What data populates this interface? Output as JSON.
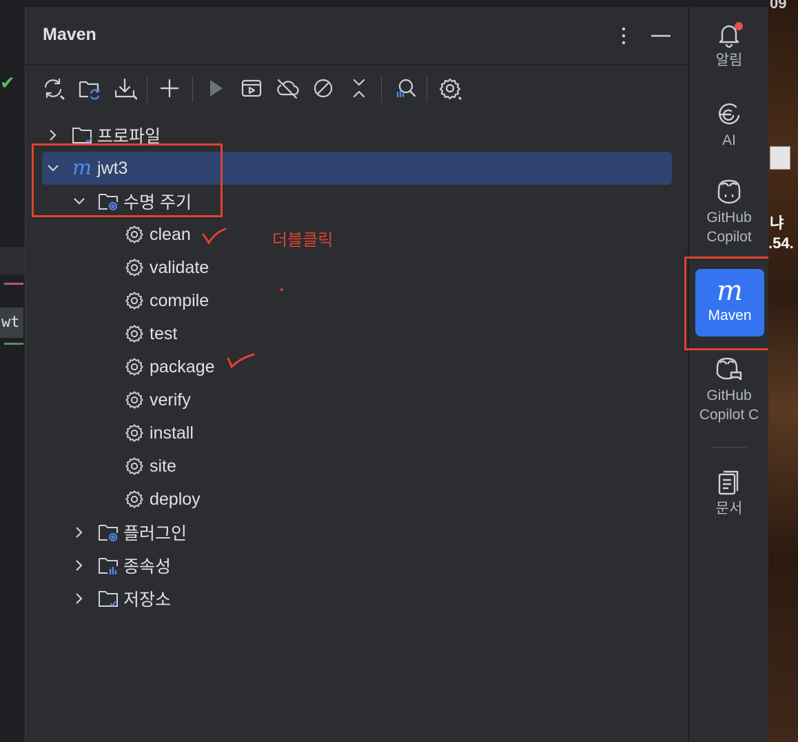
{
  "editor": {
    "tab_fragment": "wt"
  },
  "panel": {
    "title": "Maven"
  },
  "toolbar": {
    "buttons": [
      "reload-all-icon",
      "reload-project-icon",
      "download-icon",
      "add-icon",
      "run-icon",
      "execute-goal-icon",
      "offline-mode-icon",
      "skip-tests-icon",
      "collapse-icon",
      "analyze-dependencies-icon",
      "settings-icon"
    ]
  },
  "tree": {
    "profiles": "프로파일",
    "project": "jwt3",
    "lifecycle": "수명 주기",
    "goals": [
      "clean",
      "validate",
      "compile",
      "test",
      "package",
      "verify",
      "install",
      "site",
      "deploy"
    ],
    "plugins": "플러그인",
    "dependencies": "종속성",
    "repositories": "저장소"
  },
  "annotation": {
    "note": "더블클릭",
    "color": "#e0422f"
  },
  "tool_strip": {
    "notifications": "알림",
    "ai": "AI",
    "copilot_line1": "GitHub",
    "copilot_line2": "Copilot",
    "maven": "Maven",
    "copilot_chat_line1": "GitHub",
    "copilot_chat_line2": "Copilot C",
    "docs": "문서"
  },
  "wallpaper": {
    "top_text": "09",
    "mid_char": "냐",
    "number": ".54."
  },
  "colors": {
    "panel_bg": "#2b2d30",
    "selection": "#2e436e",
    "accent": "#3574f0",
    "maven_logo": "#548af7"
  }
}
